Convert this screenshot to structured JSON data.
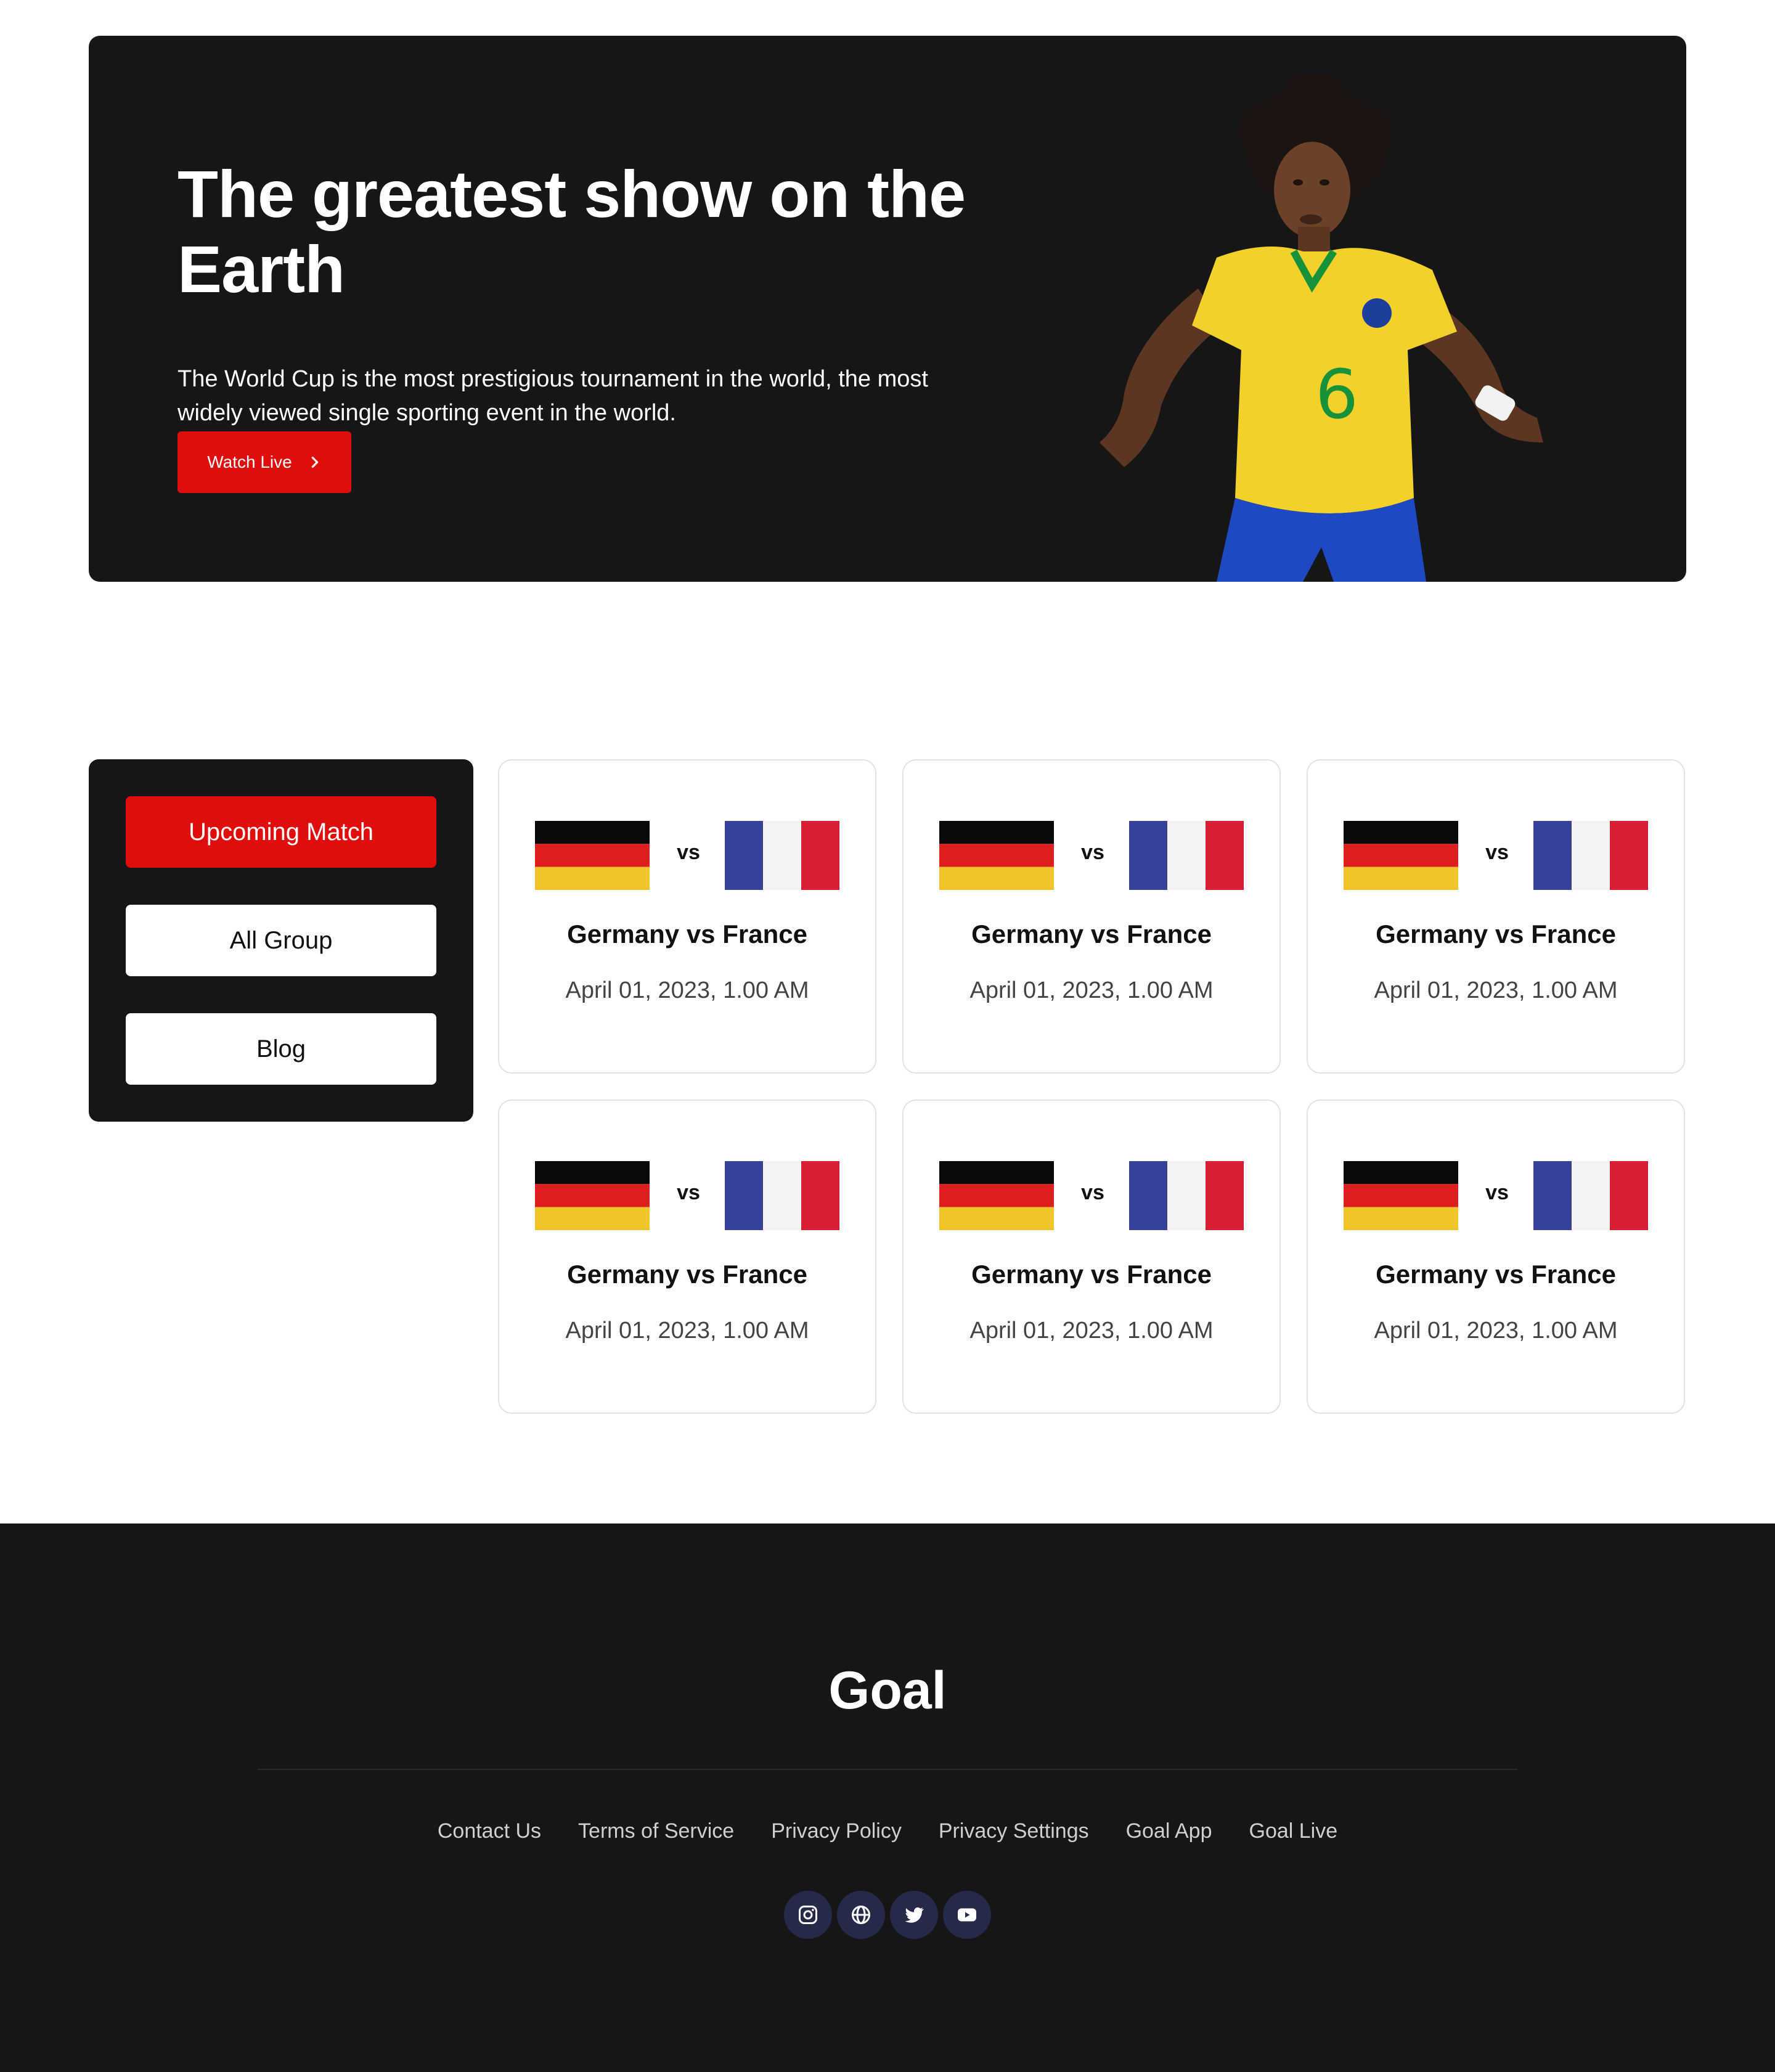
{
  "hero": {
    "title": "The greatest show on the Earth",
    "subtitle": "The World Cup is the most prestigious tournament in the world, the most widely viewed single sporting event in the world.",
    "button_label": "Watch Live"
  },
  "sidebar": {
    "items": [
      {
        "label": "Upcoming Match",
        "active": true
      },
      {
        "label": "All Group",
        "active": false
      },
      {
        "label": "Blog",
        "active": false
      }
    ]
  },
  "matches": [
    {
      "home": "Germany",
      "away": "France",
      "vs": "vs",
      "title": "Germany vs France",
      "date": "April 01, 2023, 1.00 AM"
    },
    {
      "home": "Germany",
      "away": "France",
      "vs": "vs",
      "title": "Germany vs France",
      "date": "April 01, 2023, 1.00 AM"
    },
    {
      "home": "Germany",
      "away": "France",
      "vs": "vs",
      "title": "Germany vs France",
      "date": "April 01, 2023, 1.00 AM"
    },
    {
      "home": "Germany",
      "away": "France",
      "vs": "vs",
      "title": "Germany vs France",
      "date": "April 01, 2023, 1.00 AM"
    },
    {
      "home": "Germany",
      "away": "France",
      "vs": "vs",
      "title": "Germany vs France",
      "date": "April 01, 2023, 1.00 AM"
    },
    {
      "home": "Germany",
      "away": "France",
      "vs": "vs",
      "title": "Germany vs France",
      "date": "April 01, 2023, 1.00 AM"
    }
  ],
  "footer": {
    "logo": "Goal",
    "links": [
      "Contact Us",
      "Terms of Service",
      "Privacy Policy",
      "Privacy Settings",
      "Goal App",
      "Goal Live"
    ],
    "socials": [
      "instagram-icon",
      "globe-icon",
      "twitter-icon",
      "youtube-icon"
    ]
  },
  "colors": {
    "accent": "#e00d0d",
    "dark": "#161616",
    "social_bg": "#262a4a"
  }
}
